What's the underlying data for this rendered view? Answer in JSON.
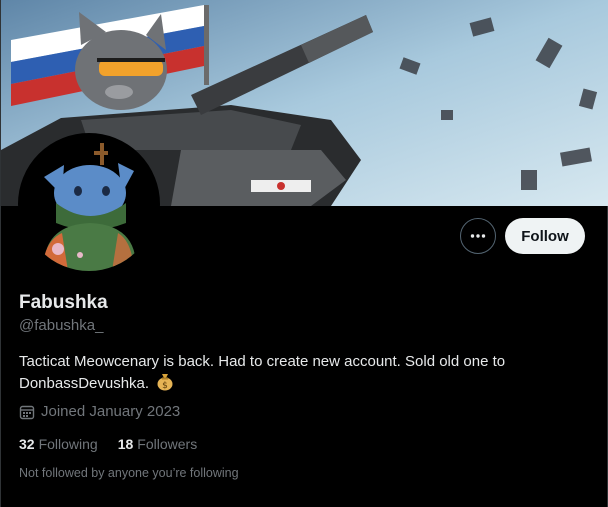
{
  "profile": {
    "name": "Fabushka",
    "handle": "@fabushka_",
    "bio": "Tacticat Meowcenary is back. Had to create new account. Sold old one to DonbassDevushka.",
    "bio_emoji_icon": "money-bag-icon",
    "joined": "Joined January 2023",
    "following_count": "32",
    "following_label": "Following",
    "followers_count": "18",
    "followers_label": "Followers",
    "not_followed_note": "Not followed by anyone you’re following"
  },
  "actions": {
    "follow_label": "Follow",
    "more_icon": "more-horizontal-icon"
  },
  "colors": {
    "background": "#000000",
    "text_primary": "#e7e9ea",
    "text_secondary": "#71767b",
    "follow_button_bg": "#eff3f4",
    "border": "#2f3336"
  }
}
